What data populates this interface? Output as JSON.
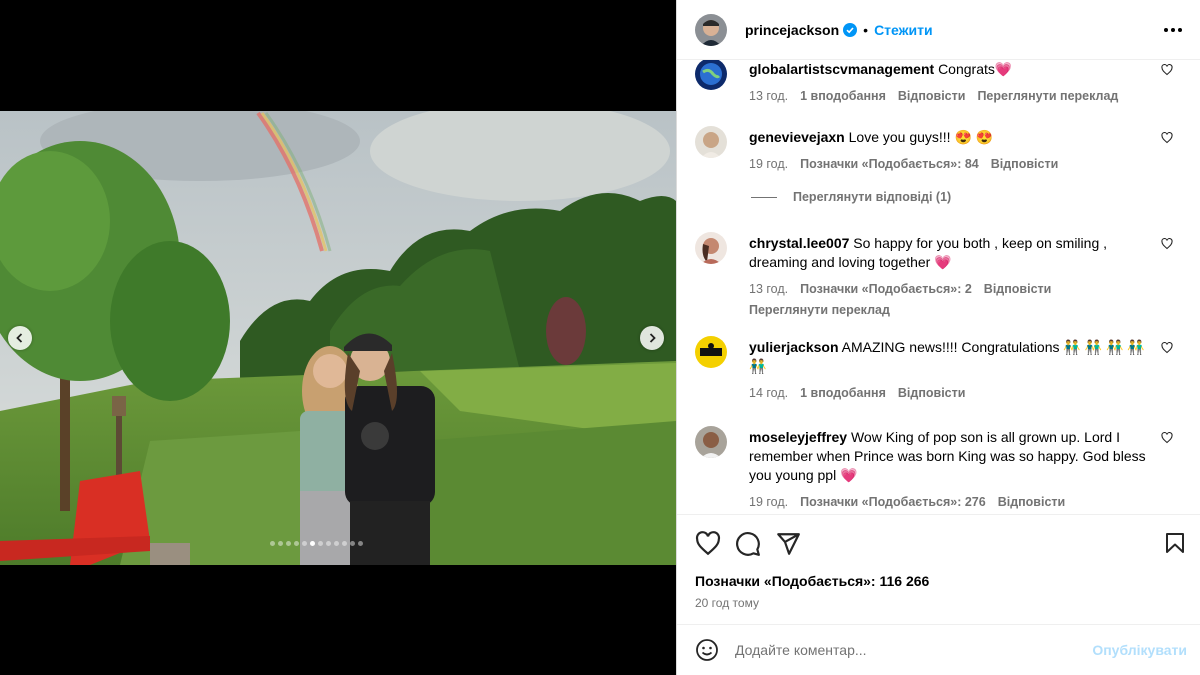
{
  "post": {
    "username": "princejackson",
    "separator": "•",
    "follow_label": "Стежити",
    "image_alt": "Couple hugging in a garden under a rainbow",
    "carousel_total": 12,
    "carousel_active": 5
  },
  "comments": [
    {
      "user": "globalartistscvmanagement",
      "text": "Congrats💗",
      "time": "13 год.",
      "likes": "1 вподобання",
      "reply": "Відповісти",
      "translate": "Переглянути переклад"
    },
    {
      "user": "genevievejaxn",
      "text": "Love you guys!!! 😍 😍",
      "time": "19 год.",
      "likes": "Позначки «Подобається»: 84",
      "reply": "Відповісти"
    },
    {
      "user": "chrystal.lee007",
      "text": "So happy for you both , keep on smiling , dreaming and loving together 💗",
      "time": "13 год.",
      "likes": "Позначки «Подобається»: 2",
      "reply": "Відповісти",
      "translate": "Переглянути переклад"
    },
    {
      "user": "yulierjackson",
      "text": "AMAZING news!!!! Congratulations 👬 👬 👬 👬 👬",
      "time": "14 год.",
      "likes": "1 вподобання",
      "reply": "Відповісти"
    },
    {
      "user": "moseleyjeffrey",
      "text": "Wow King of pop son is all grown up. Lord I remember when Prince was born King was so happy. God bless you young ppl 💗",
      "time": "19 год.",
      "likes": "Позначки «Подобається»: 276",
      "reply": "Відповісти"
    }
  ],
  "view_replies": "Переглянути відповіді (1)",
  "likes_total": "Позначки «Подобається»: 116 266",
  "posted_ago": "20 год тому",
  "add_comment_placeholder": "Додайте коментар...",
  "publish_label": "Опублікувати",
  "colors": {
    "accent": "#0095f6",
    "publish_disabled": "#b2dffc",
    "muted": "#737373"
  }
}
